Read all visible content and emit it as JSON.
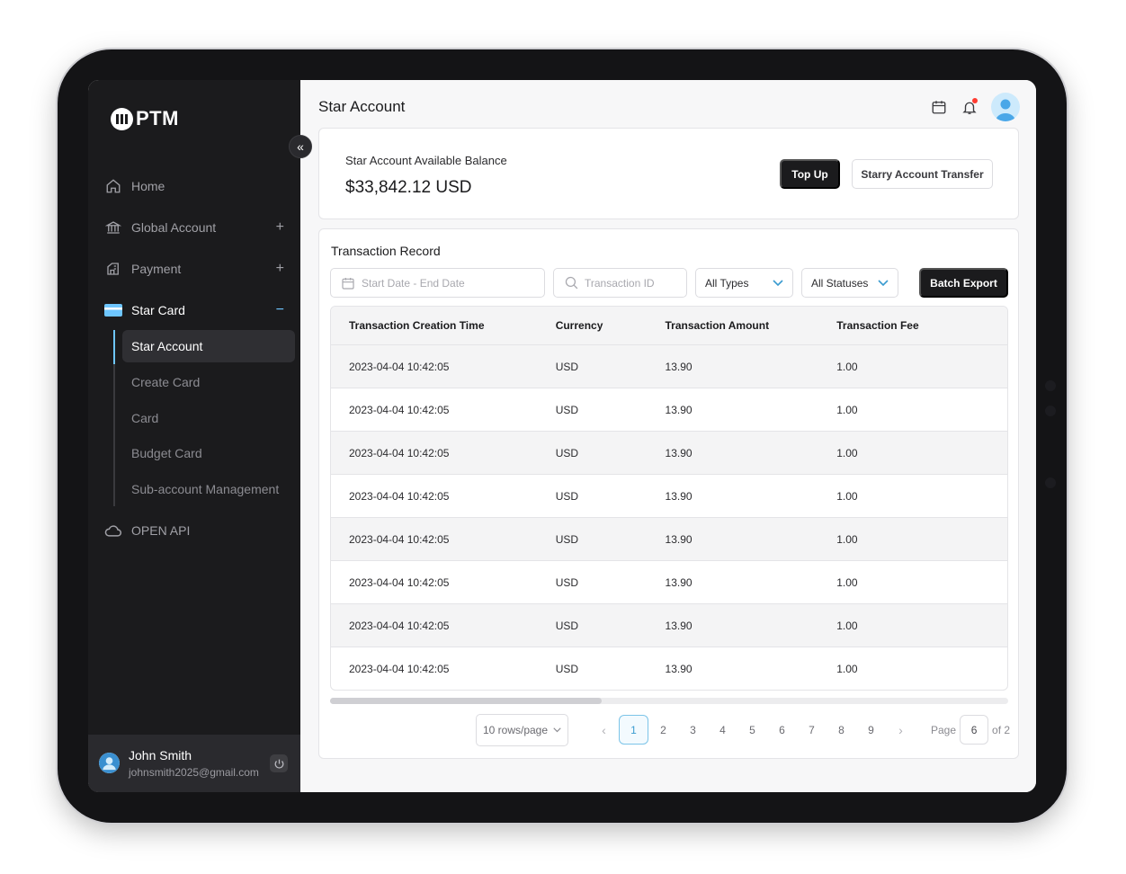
{
  "brand": {
    "name": "PTM"
  },
  "sidebar": {
    "items": [
      {
        "label": "Home",
        "icon": "home-icon",
        "sign": ""
      },
      {
        "label": "Global Account",
        "icon": "bank-icon",
        "sign": "+"
      },
      {
        "label": "Payment",
        "icon": "payment-icon",
        "sign": "+"
      },
      {
        "label": "Star Card",
        "icon": "card-icon",
        "sign": "−"
      },
      {
        "label": "OPEN API",
        "icon": "cloud-icon",
        "sign": ""
      }
    ],
    "sub_items": [
      "Star Account",
      "Create Card",
      "Card",
      "Budget Card",
      "Sub-account Management"
    ],
    "collapse_glyph": "«"
  },
  "user": {
    "name": "John Smith",
    "email": "johnsmith2025@gmail.com"
  },
  "header": {
    "title": "Star Account"
  },
  "balance": {
    "label": "Star Account Available Balance",
    "value": "$33,842.12 USD",
    "topup_label": "Top Up",
    "transfer_label": "Starry Account Transfer"
  },
  "records": {
    "title": "Transaction Record",
    "date_placeholder": "Start Date - End Date",
    "id_placeholder": "Transaction ID",
    "type_select": "All Types",
    "status_select": "All Statuses",
    "export_label": "Batch Export",
    "columns": [
      "Transaction Creation Time",
      "Currency",
      "Transaction Amount",
      "Transaction Fee"
    ],
    "rows": [
      [
        "2023-04-04 10:42:05",
        "USD",
        "13.90",
        "1.00"
      ],
      [
        "2023-04-04 10:42:05",
        "USD",
        "13.90",
        "1.00"
      ],
      [
        "2023-04-04 10:42:05",
        "USD",
        "13.90",
        "1.00"
      ],
      [
        "2023-04-04 10:42:05",
        "USD",
        "13.90",
        "1.00"
      ],
      [
        "2023-04-04 10:42:05",
        "USD",
        "13.90",
        "1.00"
      ],
      [
        "2023-04-04 10:42:05",
        "USD",
        "13.90",
        "1.00"
      ],
      [
        "2023-04-04 10:42:05",
        "USD",
        "13.90",
        "1.00"
      ],
      [
        "2023-04-04 10:42:05",
        "USD",
        "13.90",
        "1.00"
      ]
    ]
  },
  "pagination": {
    "rows_per_page": "10 rows/page",
    "prev": "‹",
    "next": "›",
    "pages": [
      "1",
      "2",
      "3",
      "4",
      "5",
      "6",
      "7",
      "8",
      "9"
    ],
    "current": "1",
    "page_label": "Page",
    "goto_value": "6",
    "of_label": "of 2"
  },
  "colors": {
    "sidebar_bg": "#1b1b1d",
    "accent": "#6ec6ff",
    "primary_button": "#1b1b1d"
  }
}
